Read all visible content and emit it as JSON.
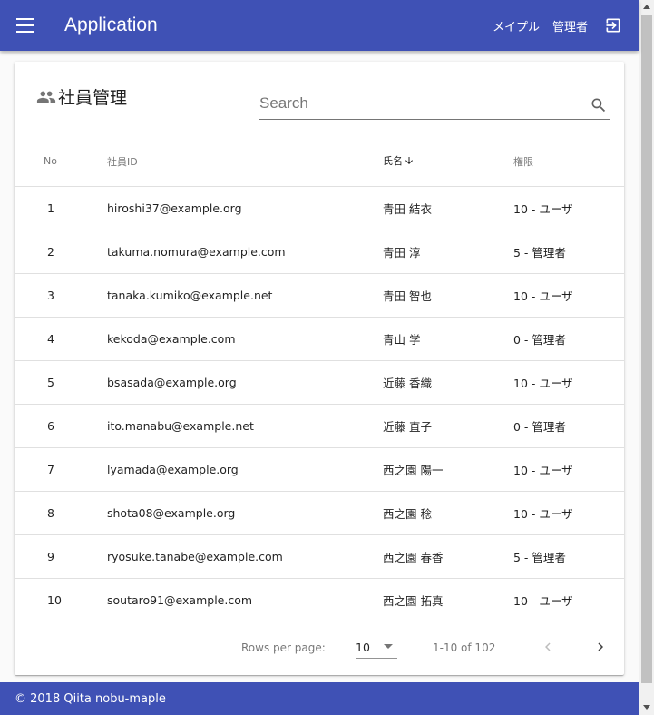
{
  "app_bar": {
    "menu_icon": "menu-icon",
    "title": "Application",
    "nav_maple": "メイプル",
    "nav_admin": "管理者",
    "logout_icon": "logout-icon"
  },
  "card": {
    "title_icon": "people-icon",
    "title": "社員管理",
    "search_placeholder": "Search",
    "search_value": ""
  },
  "table": {
    "headers": {
      "no": "No",
      "id": "社員ID",
      "name": "氏名",
      "role": "権限"
    },
    "sorted_column": "name",
    "sort_direction": "descending",
    "rows": [
      {
        "no": "1",
        "id": "hiroshi37@example.org",
        "name": "青田 結衣",
        "role": "10 - ユーザ"
      },
      {
        "no": "2",
        "id": "takuma.nomura@example.com",
        "name": "青田 淳",
        "role": "5 - 管理者"
      },
      {
        "no": "3",
        "id": "tanaka.kumiko@example.net",
        "name": "青田 智也",
        "role": "10 - ユーザ"
      },
      {
        "no": "4",
        "id": "kekoda@example.com",
        "name": "青山 学",
        "role": "0 - 管理者"
      },
      {
        "no": "5",
        "id": "bsasada@example.org",
        "name": "近藤 香織",
        "role": "10 - ユーザ"
      },
      {
        "no": "6",
        "id": "ito.manabu@example.net",
        "name": "近藤 直子",
        "role": "0 - 管理者"
      },
      {
        "no": "7",
        "id": "lyamada@example.org",
        "name": "西之園 陽一",
        "role": "10 - ユーザ"
      },
      {
        "no": "8",
        "id": "shota08@example.org",
        "name": "西之園 稔",
        "role": "10 - ユーザ"
      },
      {
        "no": "9",
        "id": "ryosuke.tanabe@example.com",
        "name": "西之園 春香",
        "role": "5 - 管理者"
      },
      {
        "no": "10",
        "id": "soutaro91@example.com",
        "name": "西之園 拓真",
        "role": "10 - ユーザ"
      }
    ]
  },
  "pagination": {
    "rows_per_page_label": "Rows per page:",
    "rows_per_page_value": "10",
    "range_text": "1-10 of 102",
    "prev_icon": "chevron-left-icon",
    "next_icon": "chevron-right-icon"
  },
  "footer": {
    "text": "© 2018 Qiita nobu-maple"
  },
  "colors": {
    "primary": "#3f51b5"
  }
}
